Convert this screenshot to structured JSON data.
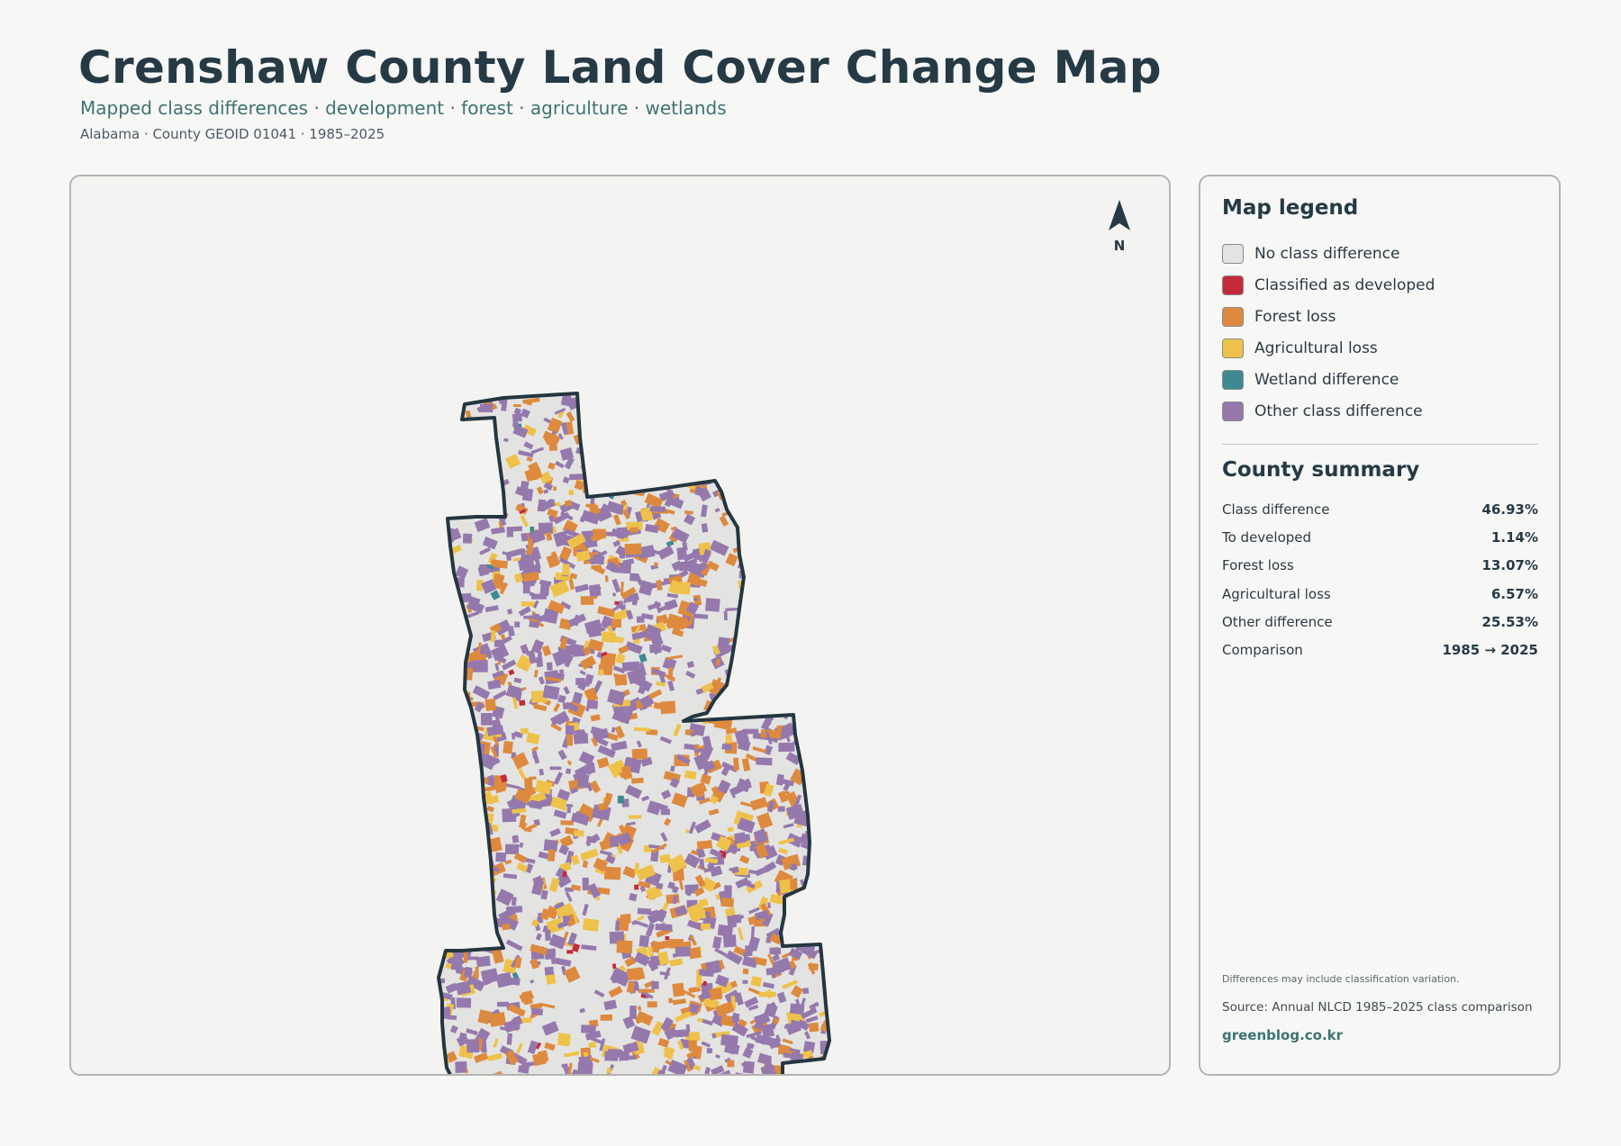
{
  "header": {
    "title": "Crenshaw County Land Cover Change Map",
    "subtitle": "Mapped class differences · development · forest · agriculture · wetlands",
    "meta": "Alabama · County GEOID 01041 · 1985–2025"
  },
  "map": {
    "north_label": "N"
  },
  "legend": {
    "title": "Map legend",
    "items": [
      {
        "label": "No class difference",
        "color": "#e3e3e1",
        "icon": "swatch-no-difference"
      },
      {
        "label": "Classified as developed",
        "color": "#c42a3a",
        "icon": "swatch-developed"
      },
      {
        "label": "Forest loss",
        "color": "#dd8a3f",
        "icon": "swatch-forest-loss"
      },
      {
        "label": "Agricultural loss",
        "color": "#eec24a",
        "icon": "swatch-agricultural-loss"
      },
      {
        "label": "Wetland difference",
        "color": "#3f8a92",
        "icon": "swatch-wetland"
      },
      {
        "label": "Other class difference",
        "color": "#9579ad",
        "icon": "swatch-other"
      }
    ]
  },
  "summary": {
    "title": "County summary",
    "rows": [
      {
        "label": "Class difference",
        "value": "46.93%"
      },
      {
        "label": "To developed",
        "value": "1.14%"
      },
      {
        "label": "Forest loss",
        "value": "13.07%"
      },
      {
        "label": "Agricultural loss",
        "value": "6.57%"
      },
      {
        "label": "Other difference",
        "value": "25.53%"
      },
      {
        "label": "Comparison",
        "value": "1985 → 2025"
      }
    ]
  },
  "footer": {
    "note": "Differences may include classification variation.",
    "source": "Source: Annual NLCD 1985–2025 class comparison",
    "credit": "greenblog.co.kr"
  },
  "colors": {
    "outline": "#243640",
    "accent": "#3d7370"
  }
}
